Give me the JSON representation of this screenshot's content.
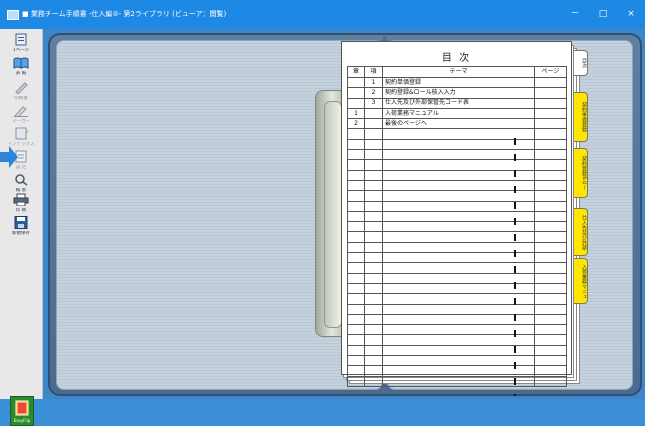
{
  "window": {
    "title": "■ 業務チーム手順書 -仕入編②- 第2ライブラリ (ビューア：閲覧)",
    "minimize_glyph": "－",
    "maximize_glyph": "□",
    "close_glyph": "×"
  },
  "toolbar": {
    "tools": [
      {
        "name": "page-nav",
        "label": "1ページ"
      },
      {
        "name": "display",
        "label": "表 紙"
      },
      {
        "name": "print",
        "label": "印刷後"
      },
      {
        "name": "pen",
        "label": "マーカー"
      },
      {
        "name": "index",
        "label": "インデックス"
      },
      {
        "name": "print-setup",
        "label": "設 定"
      },
      {
        "name": "search",
        "label": "検 索"
      },
      {
        "name": "print2",
        "label": "印 刷"
      },
      {
        "name": "save",
        "label": "新規保存"
      }
    ],
    "easyflip_label": "EasyFlip"
  },
  "toc": {
    "title": "目 次",
    "headers": {
      "chapter": "章",
      "item": "項",
      "theme": "テーマ",
      "page": "ページ"
    },
    "rows": [
      {
        "chapter": "",
        "item": "1",
        "theme": "契約単価登録",
        "page": ""
      },
      {
        "chapter": "",
        "item": "2",
        "theme": "契約登録&ロール枝入入力",
        "page": ""
      },
      {
        "chapter": "",
        "item": "3",
        "theme": "仕入先及び外部保管先コード表",
        "page": ""
      },
      {
        "chapter": "1",
        "item": "",
        "theme": "入荷業務マニュアル",
        "page": ""
      },
      {
        "chapter": "2",
        "item": "",
        "theme": "最後のページへ",
        "page": ""
      }
    ]
  },
  "tabs": [
    {
      "label": "目次",
      "color": "white"
    },
    {
      "label": "契約単価登録",
      "color": "yellow"
    },
    {
      "label": "契約登録&ロー",
      "color": "yellow"
    },
    {
      "label": "仕入先及び外部",
      "color": "yellow"
    },
    {
      "label": "入荷業務マニュ",
      "color": "yellow"
    }
  ],
  "colors": {
    "titlebar": "#1e88e5",
    "tab_yellow": "#ffe600",
    "arrow": "#2e86d9"
  }
}
